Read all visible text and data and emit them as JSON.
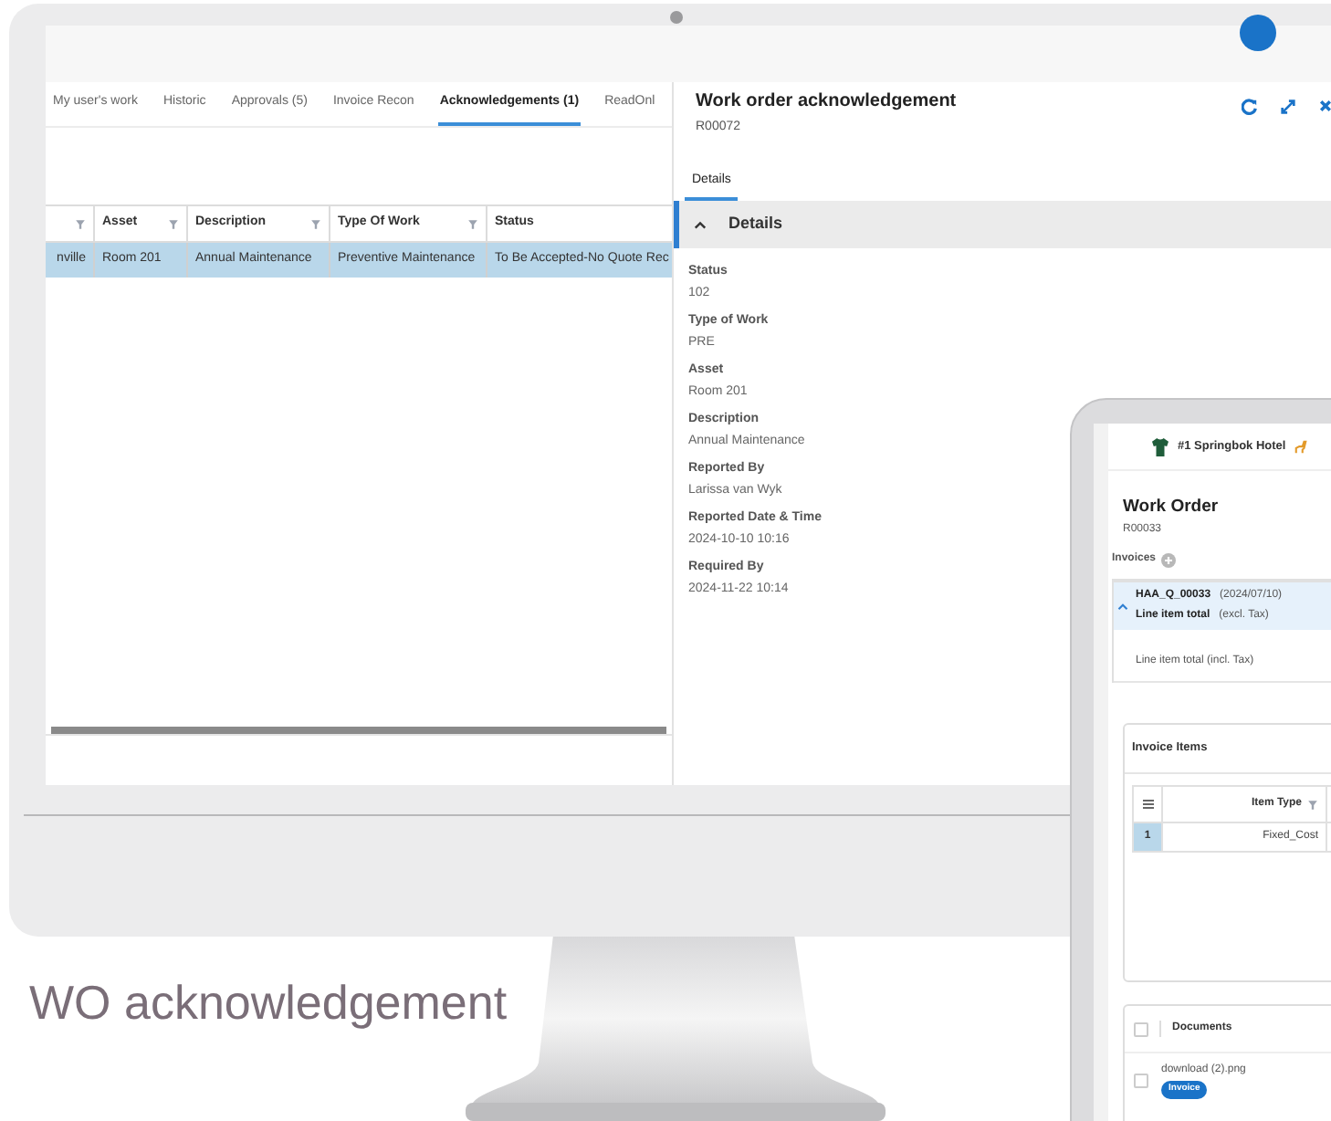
{
  "monitor": {
    "tabs": [
      {
        "label": "My user's work",
        "selected": false
      },
      {
        "label": "Historic",
        "selected": false
      },
      {
        "label": "Approvals (5)",
        "selected": false
      },
      {
        "label": "Invoice Recon",
        "selected": false
      },
      {
        "label": "Acknowledgements (1)",
        "selected": true
      },
      {
        "label": "ReadOnl",
        "selected": false
      }
    ],
    "table": {
      "columns": [
        "",
        "Asset",
        "Description",
        "Type Of Work",
        "Status"
      ],
      "rows": [
        {
          "selected": true,
          "cells": [
            "nville",
            "Room 201",
            "Annual Maintenance",
            "Preventive Maintenance",
            "To Be Accepted-No Quote Rec"
          ]
        }
      ]
    },
    "detail_panel": {
      "title": "Work order acknowledgement",
      "id": "R00072",
      "tab": {
        "label": "Details",
        "selected": true
      },
      "section": {
        "title": "Details",
        "expanded": true
      },
      "fields": [
        {
          "label": "Status",
          "value": "102"
        },
        {
          "label": "Type of Work",
          "value": "PRE"
        },
        {
          "label": "Asset",
          "value": "Room 201"
        },
        {
          "label": "Description",
          "value": "Annual Maintenance"
        },
        {
          "label": "Reported By",
          "value": "Larissa van Wyk"
        },
        {
          "label": "Reported Date & Time",
          "value": "2024-10-10 10:16"
        },
        {
          "label": "Required By",
          "value": "2024-11-22 10:14"
        }
      ]
    }
  },
  "tablet": {
    "site": "#1 Springbok Hotel",
    "title": "Work Order",
    "id": "R00033",
    "invoices_label": "Invoices",
    "invoice": {
      "number": "HAA_Q_00033",
      "date": "(2024/07/10)",
      "total_label": "Line item total",
      "total_note": "(excl. Tax)",
      "total_incl": "Line item total (incl. Tax)",
      "expanded": true
    },
    "invoice_items": {
      "title": "Invoice Items",
      "columns": [
        "Item Type"
      ],
      "rows": [
        {
          "index": "1",
          "item_type": "Fixed_Cost",
          "selected": true
        }
      ]
    },
    "documents": {
      "title": "Documents",
      "all_checked": false,
      "files": [
        {
          "name": "download (2).png",
          "tag": "Invoice",
          "checked": false
        }
      ]
    }
  },
  "caption": "WO acknowledgement"
}
